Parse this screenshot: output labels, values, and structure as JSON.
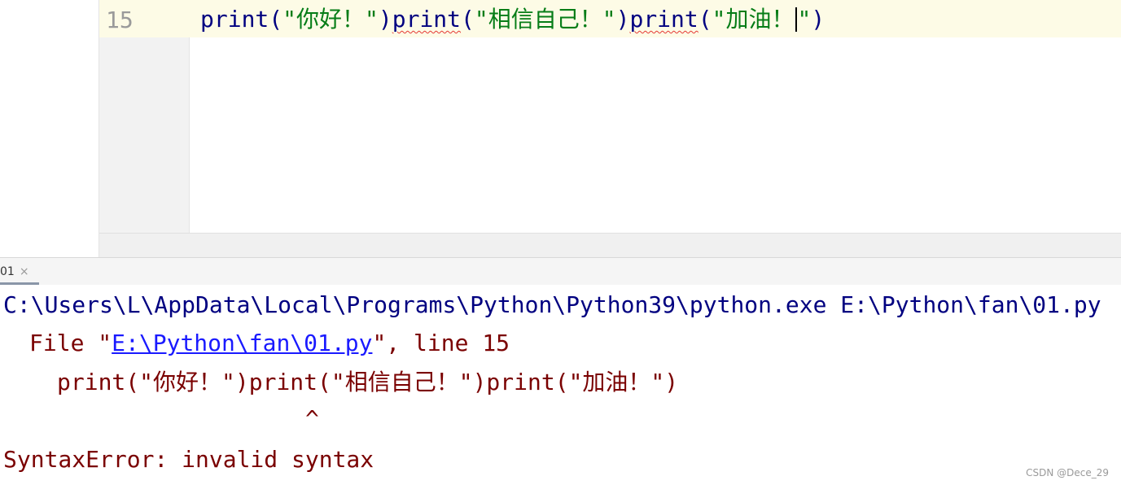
{
  "editor": {
    "line_number": "15",
    "code": {
      "p1_kw": "print",
      "p1_open": "(",
      "p1_str": "\"你好！\"",
      "p1_close": ")",
      "p2_kw": "print",
      "p2_open": "(",
      "p2_str": "\"相信自己！\"",
      "p2_close": ")",
      "p3_kw": "print",
      "p3_open": "(",
      "p3_str_a": "\"加油！",
      "p3_str_b": "\"",
      "p3_close": ")"
    }
  },
  "run_panel": {
    "tab_label": "01",
    "close_label": "×"
  },
  "console": {
    "command": "C:\\Users\\L\\AppData\\Local\\Programs\\Python\\Python39\\python.exe E:\\Python\\fan\\01.py",
    "file_prefix": "File \"",
    "file_link": "E:\\Python\\fan\\01.py",
    "file_suffix": "\", line 15",
    "code_echo": "print(\"你好！\")print(\"相信自己！\")print(\"加油！\")",
    "caret": "^",
    "error": "SyntaxError: invalid syntax"
  },
  "watermark": "CSDN @Dece_29",
  "colors": {
    "keyword": "#000080",
    "string": "#067d17",
    "error_text": "#7a0000",
    "link": "#1a1aff",
    "current_line": "#fdfbe6"
  }
}
